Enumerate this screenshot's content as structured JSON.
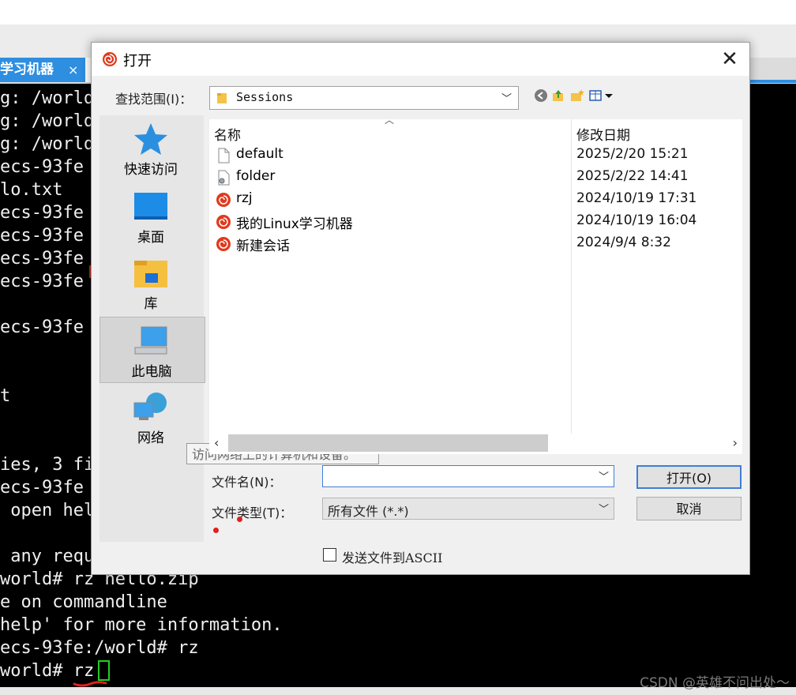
{
  "background_app": {
    "tab_label": "学习机器",
    "tab_close": "×",
    "terminal_lines": [
      "g: /world",
      "g: /world",
      "g: /world",
      "ecs-93fe",
      "lo.txt",
      "ecs-93fe",
      "ecs-93fe",
      "ecs-93fe",
      "ecs-93fe",
      "",
      "ecs-93fe",
      "",
      "",
      "t",
      "",
      "",
      "ies, 3 fi",
      "ecs-93fe",
      " open hel",
      "",
      " any requ",
      "world# rz hello.zip",
      "e on commandline",
      "help' for more information.",
      "ecs-93fe:/world# rz",
      "world# rz"
    ],
    "watermark": "CSDN @英雄不问出处～"
  },
  "dialog": {
    "title": "打开",
    "close_glyph": "✕",
    "look_in_label": "查找范围(I)：",
    "look_in_value": "Sessions",
    "toolbar_icons": [
      "back-icon",
      "up-folder-icon",
      "new-folder-icon",
      "view-menu-icon"
    ],
    "places": [
      {
        "label": "快速访问",
        "icon": "star-icon"
      },
      {
        "label": "桌面",
        "icon": "desktop-icon"
      },
      {
        "label": "库",
        "icon": "library-icon"
      },
      {
        "label": "此电脑",
        "icon": "computer-icon"
      },
      {
        "label": "网络",
        "icon": "network-icon"
      }
    ],
    "selected_place": "此电脑",
    "tooltip": "访问网络上的计算机和设备。",
    "columns": {
      "name": "名称",
      "date": "修改日期"
    },
    "files": [
      {
        "name": "default",
        "date": "2025/2/20 15:21",
        "icon": "file-icon"
      },
      {
        "name": "folder",
        "date": "2025/2/22 14:41",
        "icon": "settings-file-icon"
      },
      {
        "name": "rzj",
        "date": "2024/10/19 17:31",
        "icon": "session-icon"
      },
      {
        "name": "我的Linux学习机器",
        "date": "2024/10/19 16:04",
        "icon": "session-icon"
      },
      {
        "name": "新建会话",
        "date": "2024/9/4 8:32",
        "icon": "session-icon"
      }
    ],
    "file_name_label": "文件名(N)：",
    "file_name_value": "",
    "file_type_label": "文件类型(T)：",
    "file_type_value": "所有文件 (*.*)",
    "open_button": "打开(O)",
    "cancel_button": "取消",
    "send_ascii_label": "发送文件到ASCII",
    "send_ascii_checked": false
  },
  "colors": {
    "accent": "#2e8ee0",
    "terminal_bg": "#000000",
    "session_red": "#e03a1e"
  }
}
